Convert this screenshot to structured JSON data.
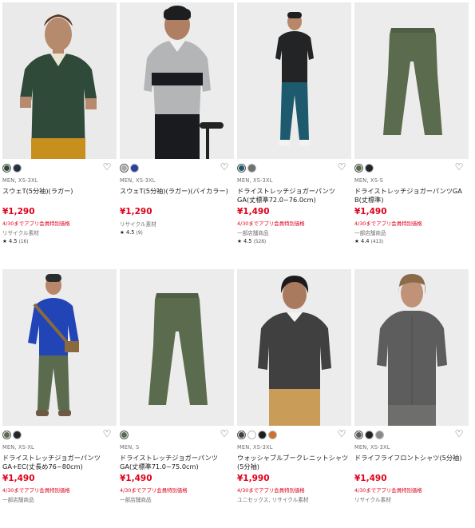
{
  "products": [
    {
      "colors": [
        "#2f4a39",
        "#26303d"
      ],
      "meta": "MEN, XS-3XL",
      "name": "スウェT(5分袖)(ラガー)",
      "price": "¥1,290",
      "promo": "4/30までアプリ会員特別価格",
      "note": "リサイクル素材",
      "rating": "★ 4.5",
      "reviews": "(16)",
      "image": "model-green-rugby"
    },
    {
      "colors": [
        "#a7a9ab",
        "#2c3f9a"
      ],
      "meta": "MEN, XS-3XL",
      "name": "スウェT(5分袖)(ラガー)(バイカラー)",
      "price": "¥1,290",
      "promo": "",
      "note": "リサイクル素材",
      "rating": "★ 4.5",
      "reviews": "(9)",
      "image": "model-gray-bicolor"
    },
    {
      "colors": [
        "#1d5a6e",
        "#6d7170"
      ],
      "meta": "MEN, XS-3XL",
      "name": "ドライストレッチジョガーパンツGA(丈標準72.0~76.0cm)",
      "price": "¥1,490",
      "promo": "4/30までアプリ会員特別価格",
      "note": "一部店舗商品",
      "rating": "★ 4.5",
      "reviews": "(528)",
      "image": "model-teal-jogger"
    },
    {
      "colors": [
        "#5b6b4e",
        "#22252a"
      ],
      "meta": "MEN, XS-S",
      "name": "ドライストレッチジョガーパンツGA B(丈標準)",
      "price": "¥1,490",
      "promo": "4/30までアプリ会員特別価格",
      "note": "一部店舗商品",
      "rating": "★ 4.4",
      "reviews": "(413)",
      "image": "olive-pants"
    },
    {
      "colors": [
        "#5b6b4e",
        "#22252a"
      ],
      "meta": "MEN, XS-XL",
      "name": "ドライストレッチジョガーパンツGA+EC(丈長め76~80cm)",
      "price": "¥1,490",
      "promo": "4/30までアプリ会員特別価格",
      "note": "一部店舗商品",
      "rating": "",
      "reviews": "",
      "image": "model-blue-sweater"
    },
    {
      "colors": [
        "#5b6b4e"
      ],
      "meta": "MEN, S",
      "name": "ドライストレッチジョガーパンツGA(丈標準71.0~75.0cm)",
      "price": "¥1,490",
      "promo": "4/30までアプリ会員特別価格",
      "note": "一部店舗商品",
      "rating": "",
      "reviews": "",
      "image": "olive-pants"
    },
    {
      "colors": [
        "#3f403f",
        "#ffffff",
        "#1c1d1f",
        "#d07030"
      ],
      "meta": "MEN, XS-3XL",
      "name": "ウォッシャブルブークレニットシャツ(5分袖)",
      "price": "¥1,990",
      "promo": "4/30までアプリ会員特別価格",
      "note": "ユニセックス, リサイクル素材",
      "rating": "",
      "reviews": "",
      "image": "model-dark-knit"
    },
    {
      "colors": [
        "#5c5d5c",
        "#1f2124",
        "#8a8a88"
      ],
      "meta": "MEN, XS-3XL",
      "name": "ドライフライフロントシャツ(5分袖)",
      "price": "¥1,490",
      "promo": "4/30までアプリ会員特別価格",
      "note": "リサイクル素材",
      "rating": "",
      "reviews": "",
      "image": "model-gray-shirt"
    }
  ]
}
